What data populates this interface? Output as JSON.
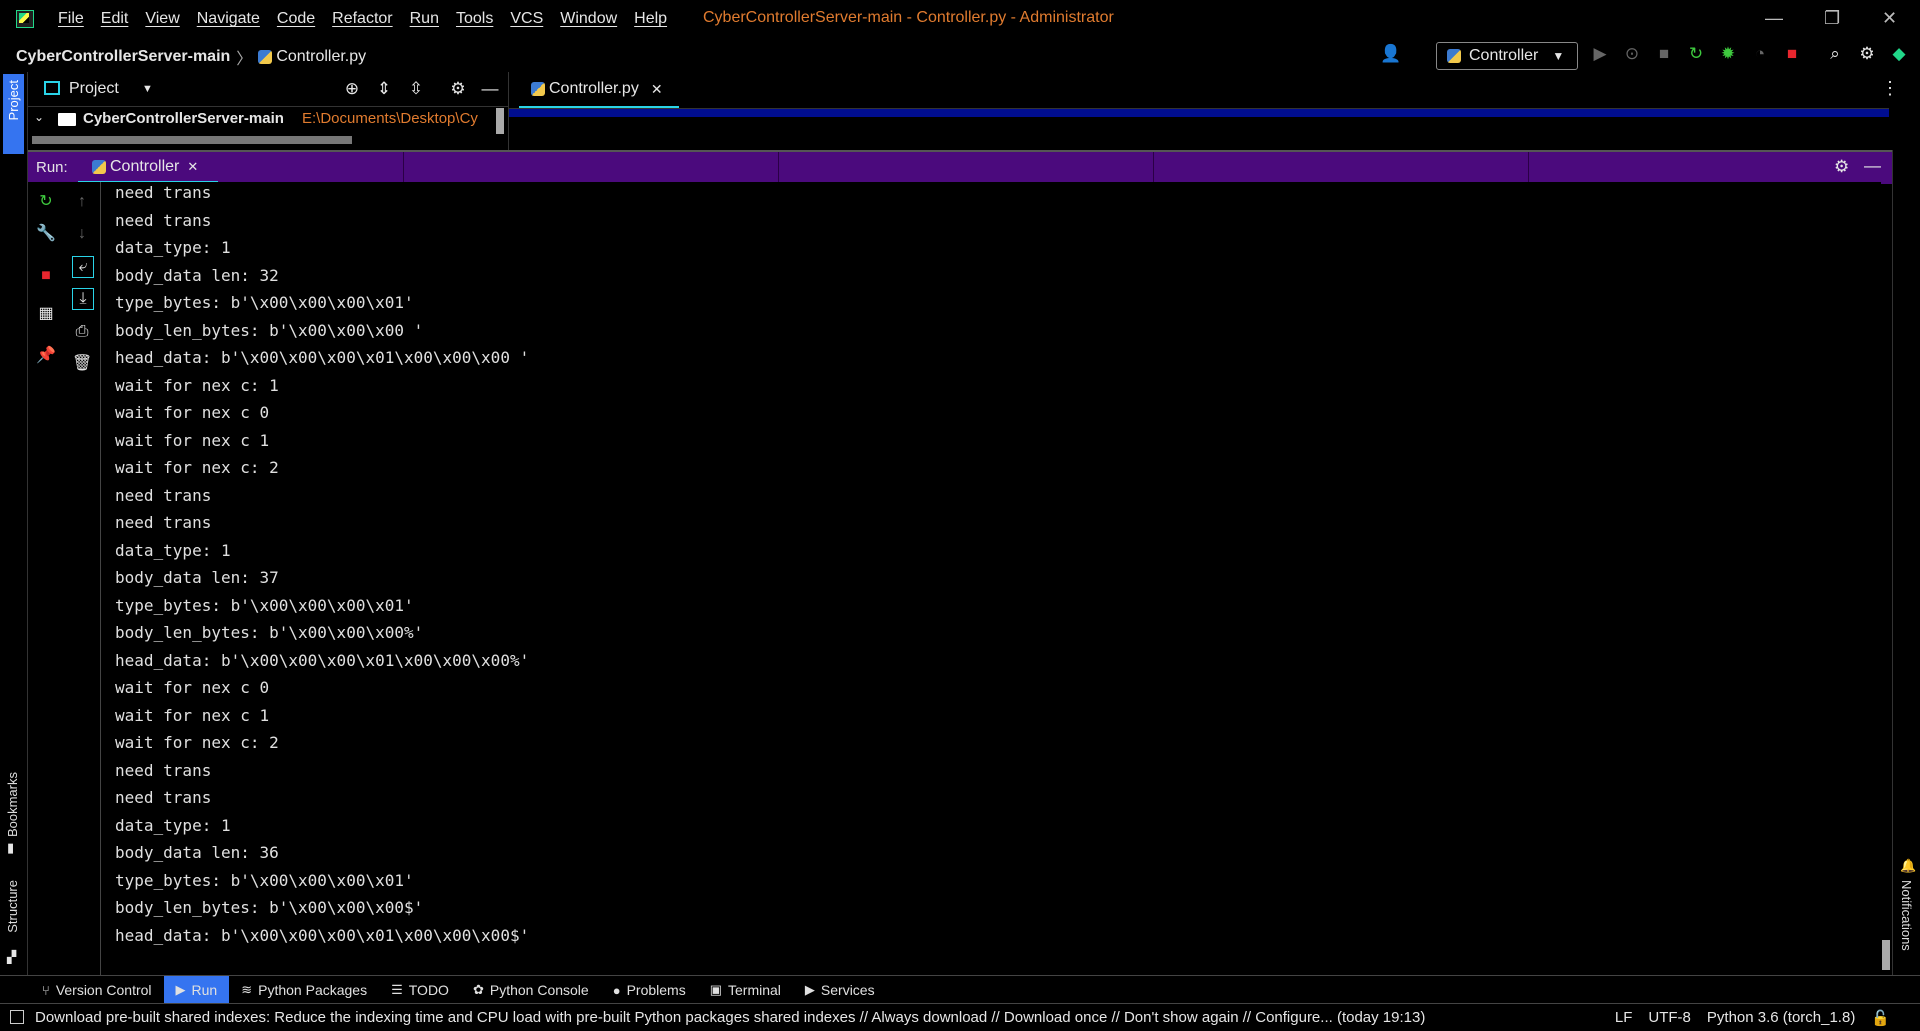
{
  "menu": [
    "File",
    "Edit",
    "View",
    "Navigate",
    "Code",
    "Refactor",
    "Run",
    "Tools",
    "VCS",
    "Window",
    "Help"
  ],
  "window_title": "CyberControllerServer-main - Controller.py - Administrator",
  "breadcrumb": {
    "project": "CyberControllerServer-main",
    "file": "Controller.py"
  },
  "run_config": "Controller",
  "project_panel": {
    "title": "Project",
    "root_name": "CyberControllerServer-main",
    "root_path": "E:\\Documents\\Desktop\\Cy"
  },
  "editor_tab": "Controller.py",
  "run_window": {
    "label": "Run:",
    "tab": "Controller"
  },
  "stripes": {
    "project": "Project",
    "bookmarks": "Bookmarks",
    "structure": "Structure",
    "notifications": "Notifications"
  },
  "console_lines": [
    "need trans",
    "need trans",
    "data_type: 1",
    "body_data len: 32",
    "type_bytes: b'\\x00\\x00\\x00\\x01'",
    "body_len_bytes: b'\\x00\\x00\\x00 '",
    "head_data: b'\\x00\\x00\\x00\\x01\\x00\\x00\\x00 '",
    "wait for nex c: 1",
    "wait for nex c 0",
    "wait for nex c 1",
    "wait for nex c: 2",
    "need trans",
    "need trans",
    "data_type: 1",
    "body_data len: 37",
    "type_bytes: b'\\x00\\x00\\x00\\x01'",
    "body_len_bytes: b'\\x00\\x00\\x00%'",
    "head_data: b'\\x00\\x00\\x00\\x01\\x00\\x00\\x00%'",
    "wait for nex c 0",
    "wait for nex c 1",
    "wait for nex c: 2",
    "need trans",
    "need trans",
    "data_type: 1",
    "body_data len: 36",
    "type_bytes: b'\\x00\\x00\\x00\\x01'",
    "body_len_bytes: b'\\x00\\x00\\x00$'",
    "head_data: b'\\x00\\x00\\x00\\x01\\x00\\x00\\x00$'"
  ],
  "bottom_tabs": [
    {
      "name": "version-control",
      "label": "Version Control",
      "icon": "⑂"
    },
    {
      "name": "run",
      "label": "Run",
      "icon": "▶"
    },
    {
      "name": "python-packages",
      "label": "Python Packages",
      "icon": "≋"
    },
    {
      "name": "todo",
      "label": "TODO",
      "icon": "☰"
    },
    {
      "name": "python-console",
      "label": "Python Console",
      "icon": "✿"
    },
    {
      "name": "problems",
      "label": "Problems",
      "icon": "●"
    },
    {
      "name": "terminal",
      "label": "Terminal",
      "icon": "▣"
    },
    {
      "name": "services",
      "label": "Services",
      "icon": "▶"
    }
  ],
  "status": {
    "message": "Download pre-built shared indexes: Reduce the indexing time and CPU load with pre-built Python packages shared indexes // Always download // Download once // Don't show again // Configure... (today 19:13)",
    "line_sep": "LF",
    "encoding": "UTF-8",
    "interpreter": "Python 3.6 (torch_1.8)"
  },
  "colors": {
    "accent": "#3574f0",
    "run_header": "#4b0a7d",
    "tab_underline": "#2ad4e8",
    "title": "#e07b2f"
  }
}
